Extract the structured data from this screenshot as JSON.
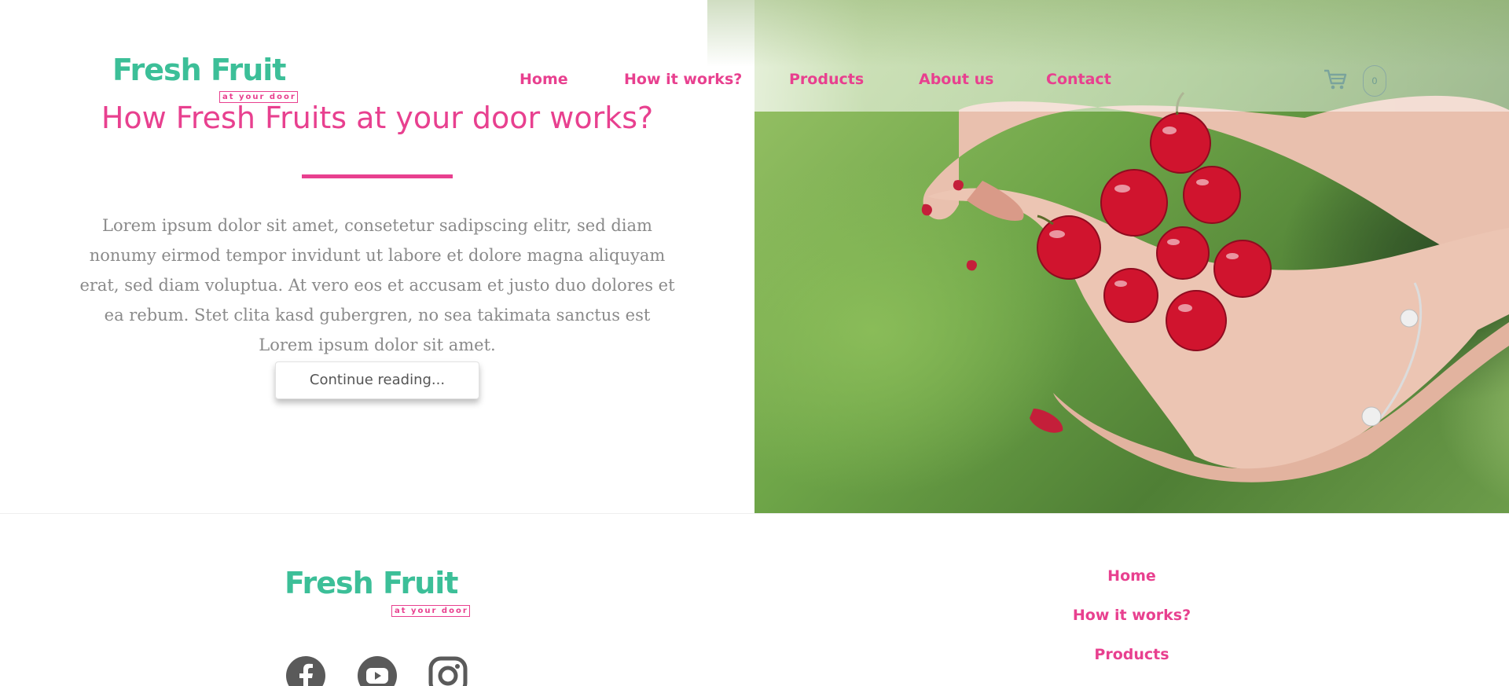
{
  "header": {
    "logo": {
      "main": "Fresh Fruit",
      "tagline": "at your door"
    },
    "nav": [
      {
        "label": "Home"
      },
      {
        "label": "How it works?"
      },
      {
        "label": "Products"
      },
      {
        "label": "About us"
      },
      {
        "label": "Contact"
      }
    ],
    "cart": {
      "icon": "cart-icon",
      "count": "0"
    }
  },
  "main": {
    "title": "How Fresh Fruits at your door works?",
    "body": "Lorem ipsum dolor sit amet, consetetur sadipscing elitr, sed diam nonumy eirmod tempor invidunt ut labore et dolore magna aliquyam erat, sed diam voluptua. At vero eos et accusam et justo duo dolores et ea rebum. Stet clita kasd gubergren, no sea takimata sanctus est Lorem ipsum dolor sit amet.",
    "button_label": "Continue reading..."
  },
  "footer": {
    "logo": {
      "main": "Fresh Fruit",
      "tagline": "at your door"
    },
    "social": [
      {
        "icon": "facebook-icon"
      },
      {
        "icon": "youtube-icon"
      },
      {
        "icon": "instagram-icon"
      }
    ],
    "nav": [
      {
        "label": "Home"
      },
      {
        "label": "How it works?"
      },
      {
        "label": "Products"
      }
    ]
  },
  "colors": {
    "brand_green": "#3cbf98",
    "brand_pink": "#e8408f",
    "body_text": "#8a8a8a"
  }
}
